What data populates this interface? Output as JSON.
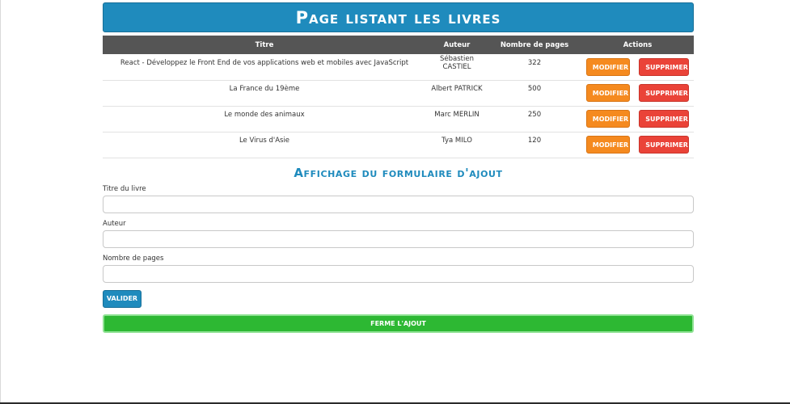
{
  "header": {
    "title": "Page listant les livres"
  },
  "table": {
    "columns": [
      "Titre",
      "Auteur",
      "Nombre de pages",
      "Actions"
    ],
    "rows": [
      {
        "titre": "React - Développez le Front End de vos applications web et mobiles avec JavaScript",
        "auteur": "Sébastien CASTIEL",
        "pages": "322"
      },
      {
        "titre": "La France du 19ème",
        "auteur": "Albert PATRICK",
        "pages": "500"
      },
      {
        "titre": "Le monde des animaux",
        "auteur": "Marc MERLIN",
        "pages": "250"
      },
      {
        "titre": "Le Virus d'Asie",
        "auteur": "Tya MILO",
        "pages": "120"
      }
    ],
    "modifier_label": "MODIFIER",
    "supprimer_label": "SUPPRIMER"
  },
  "form": {
    "title": "Affichage du formulaire d'ajout",
    "titre_label": "Titre du livre",
    "titre_value": "",
    "auteur_label": "Auteur",
    "auteur_value": "",
    "pages_label": "Nombre de pages",
    "pages_value": "",
    "valider_label": "VALIDER",
    "ferme_label": "FERME L'AJOUT"
  },
  "colors": {
    "primary": "#1f8bbd",
    "modifier": "#f58a1f",
    "supprimer": "#ea4338",
    "ferme": "#2db833",
    "table_header": "#555555"
  }
}
